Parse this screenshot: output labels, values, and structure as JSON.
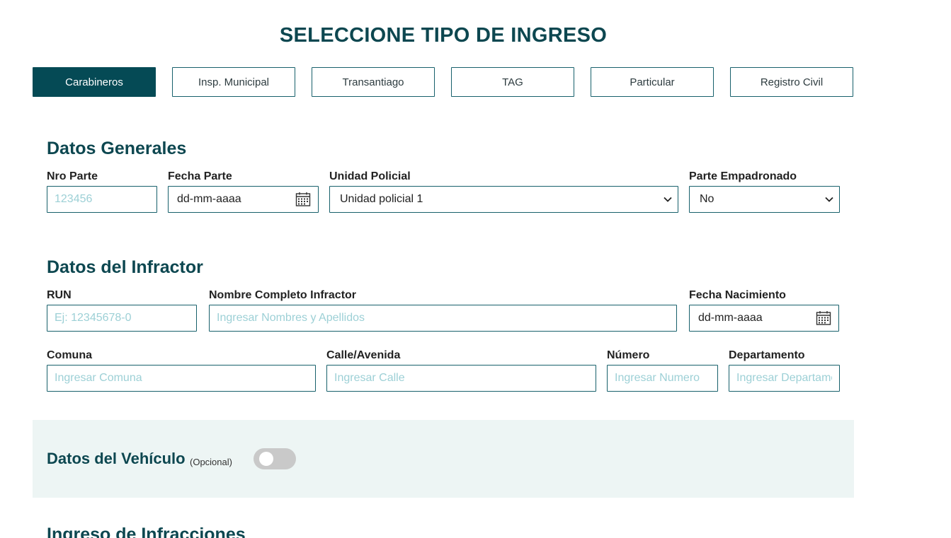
{
  "header": {
    "title": "SELECCIONE TIPO DE INGRESO"
  },
  "tabs": [
    {
      "label": "Carabineros"
    },
    {
      "label": "Insp. Municipal"
    },
    {
      "label": "Transantiago"
    },
    {
      "label": "TAG"
    },
    {
      "label": "Particular"
    },
    {
      "label": "Registro Civil"
    }
  ],
  "datos_generales": {
    "title": "Datos Generales",
    "nro_parte": {
      "label": "Nro Parte",
      "placeholder": "123456"
    },
    "fecha_parte": {
      "label": "Fecha Parte",
      "value": "dd-mm-aaaa"
    },
    "unidad_policial": {
      "label": "Unidad Policial",
      "value": "Unidad policial 1"
    },
    "parte_empadronado": {
      "label": "Parte Empadronado",
      "value": "No"
    }
  },
  "datos_infractor": {
    "title": "Datos del Infractor",
    "run": {
      "label": "RUN",
      "placeholder": "Ej: 12345678-0"
    },
    "nombre": {
      "label": "Nombre Completo Infractor",
      "placeholder": "Ingresar Nombres y Apellidos"
    },
    "fecha_nacimiento": {
      "label": "Fecha Nacimiento",
      "value": "dd-mm-aaaa"
    },
    "comuna": {
      "label": "Comuna",
      "placeholder": "Ingresar Comuna"
    },
    "calle": {
      "label": "Calle/Avenida",
      "placeholder": "Ingresar Calle"
    },
    "numero": {
      "label": "Número",
      "placeholder": "Ingresar Numero"
    },
    "departamento": {
      "label": "Departamento",
      "placeholder": "Ingresar Departamento"
    }
  },
  "datos_vehiculo": {
    "title": "Datos del Vehículo",
    "note": "(Opcional)",
    "toggle_on": false
  },
  "ingreso_infracciones": {
    "title": "Ingreso de Infracciones"
  },
  "colors": {
    "primary": "#054a55",
    "heading": "#0d4750",
    "border": "#17606b",
    "placeholder": "#9dd0d6",
    "panel": "#edf5f4"
  }
}
